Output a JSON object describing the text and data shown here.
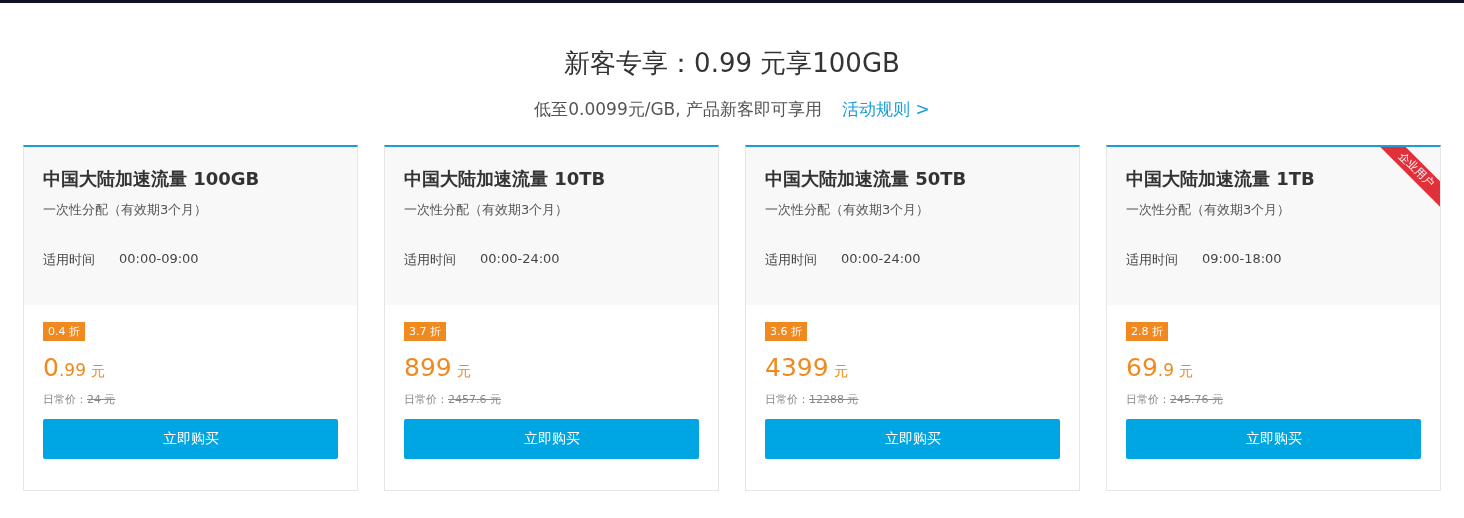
{
  "header": {
    "title": "新客专享：0.99 元享100GB",
    "subtitle": "低至0.0099元/GB, 产品新客即可享用",
    "rules_link": "活动规则 >"
  },
  "cards": [
    {
      "name": "中国大陆加速流量 100GB",
      "allocation": "一次性分配（有效期3个月）",
      "time_label": "适用时间",
      "time_range": "00:00-09:00",
      "discount": "0.4 折",
      "price_integer": "0",
      "price_decimal": ".99",
      "currency": "元",
      "regular_label": "日常价：",
      "regular_price": "24 元",
      "button": "立即购买"
    },
    {
      "name": "中国大陆加速流量 10TB",
      "allocation": "一次性分配（有效期3个月）",
      "time_label": "适用时间",
      "time_range": "00:00-24:00",
      "discount": "3.7 折",
      "price_integer": "899",
      "currency": "元",
      "regular_label": "日常价：",
      "regular_price": "2457.6 元",
      "button": "立即购买"
    },
    {
      "name": "中国大陆加速流量 50TB",
      "allocation": "一次性分配（有效期3个月）",
      "time_label": "适用时间",
      "time_range": "00:00-24:00",
      "discount": "3.6 折",
      "price_integer": "4399",
      "currency": "元",
      "regular_label": "日常价：",
      "regular_price": "12288 元",
      "button": "立即购买"
    },
    {
      "name": "中国大陆加速流量 1TB",
      "allocation": "一次性分配（有效期3个月）",
      "time_label": "适用时间",
      "time_range": "09:00-18:00",
      "discount": "2.8 折",
      "price_integer": "69",
      "price_decimal": ".9",
      "currency": "元",
      "regular_label": "日常价：",
      "regular_price": "245.76 元",
      "button": "立即购买",
      "ribbon": "企业用户"
    }
  ]
}
